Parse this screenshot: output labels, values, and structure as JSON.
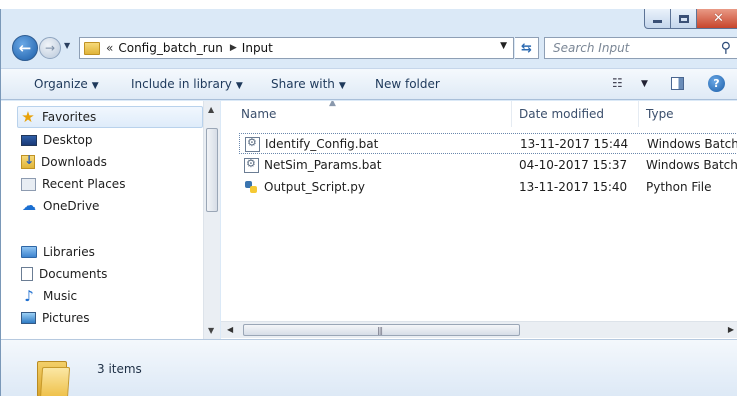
{
  "window": {
    "caption_buttons": {
      "minimize": "–",
      "maximize": "□",
      "close": "✕"
    }
  },
  "navigation": {
    "breadcrumb_prefix": "«",
    "breadcrumb": [
      "Config_batch_run",
      "Input"
    ],
    "search_placeholder": "Search Input"
  },
  "toolbar": {
    "organize": "Organize",
    "include_in_library": "Include in library",
    "share_with": "Share with",
    "new_folder": "New folder"
  },
  "nav_pane": {
    "favorites": {
      "label": "Favorites",
      "items": [
        {
          "label": "Desktop",
          "icon": "desktop-icon"
        },
        {
          "label": "Downloads",
          "icon": "downloads-icon"
        },
        {
          "label": "Recent Places",
          "icon": "recent-places-icon"
        },
        {
          "label": "OneDrive",
          "icon": "onedrive-icon"
        }
      ]
    },
    "libraries": {
      "label": "Libraries",
      "items": [
        {
          "label": "Documents",
          "icon": "documents-icon"
        },
        {
          "label": "Music",
          "icon": "music-icon"
        },
        {
          "label": "Pictures",
          "icon": "pictures-icon"
        }
      ]
    }
  },
  "file_list": {
    "columns": [
      "Name",
      "Date modified",
      "Type"
    ],
    "rows": [
      {
        "name": "Identify_Config.bat",
        "date_modified": "13-11-2017 15:44",
        "type": "Windows Batch",
        "icon": "batch-file-icon",
        "selected": true
      },
      {
        "name": "NetSim_Params.bat",
        "date_modified": "04-10-2017 15:37",
        "type": "Windows Batch",
        "icon": "batch-file-icon",
        "selected": false
      },
      {
        "name": "Output_Script.py",
        "date_modified": "13-11-2017 15:40",
        "type": "Python File",
        "icon": "python-file-icon",
        "selected": false
      }
    ]
  },
  "details_pane": {
    "item_count": "3 items"
  },
  "colors": {
    "frame": "#dbe9f7",
    "command_bar": "#dfeaf6",
    "selection_border": "#b9d2ec",
    "close_button": "#c7452c"
  }
}
